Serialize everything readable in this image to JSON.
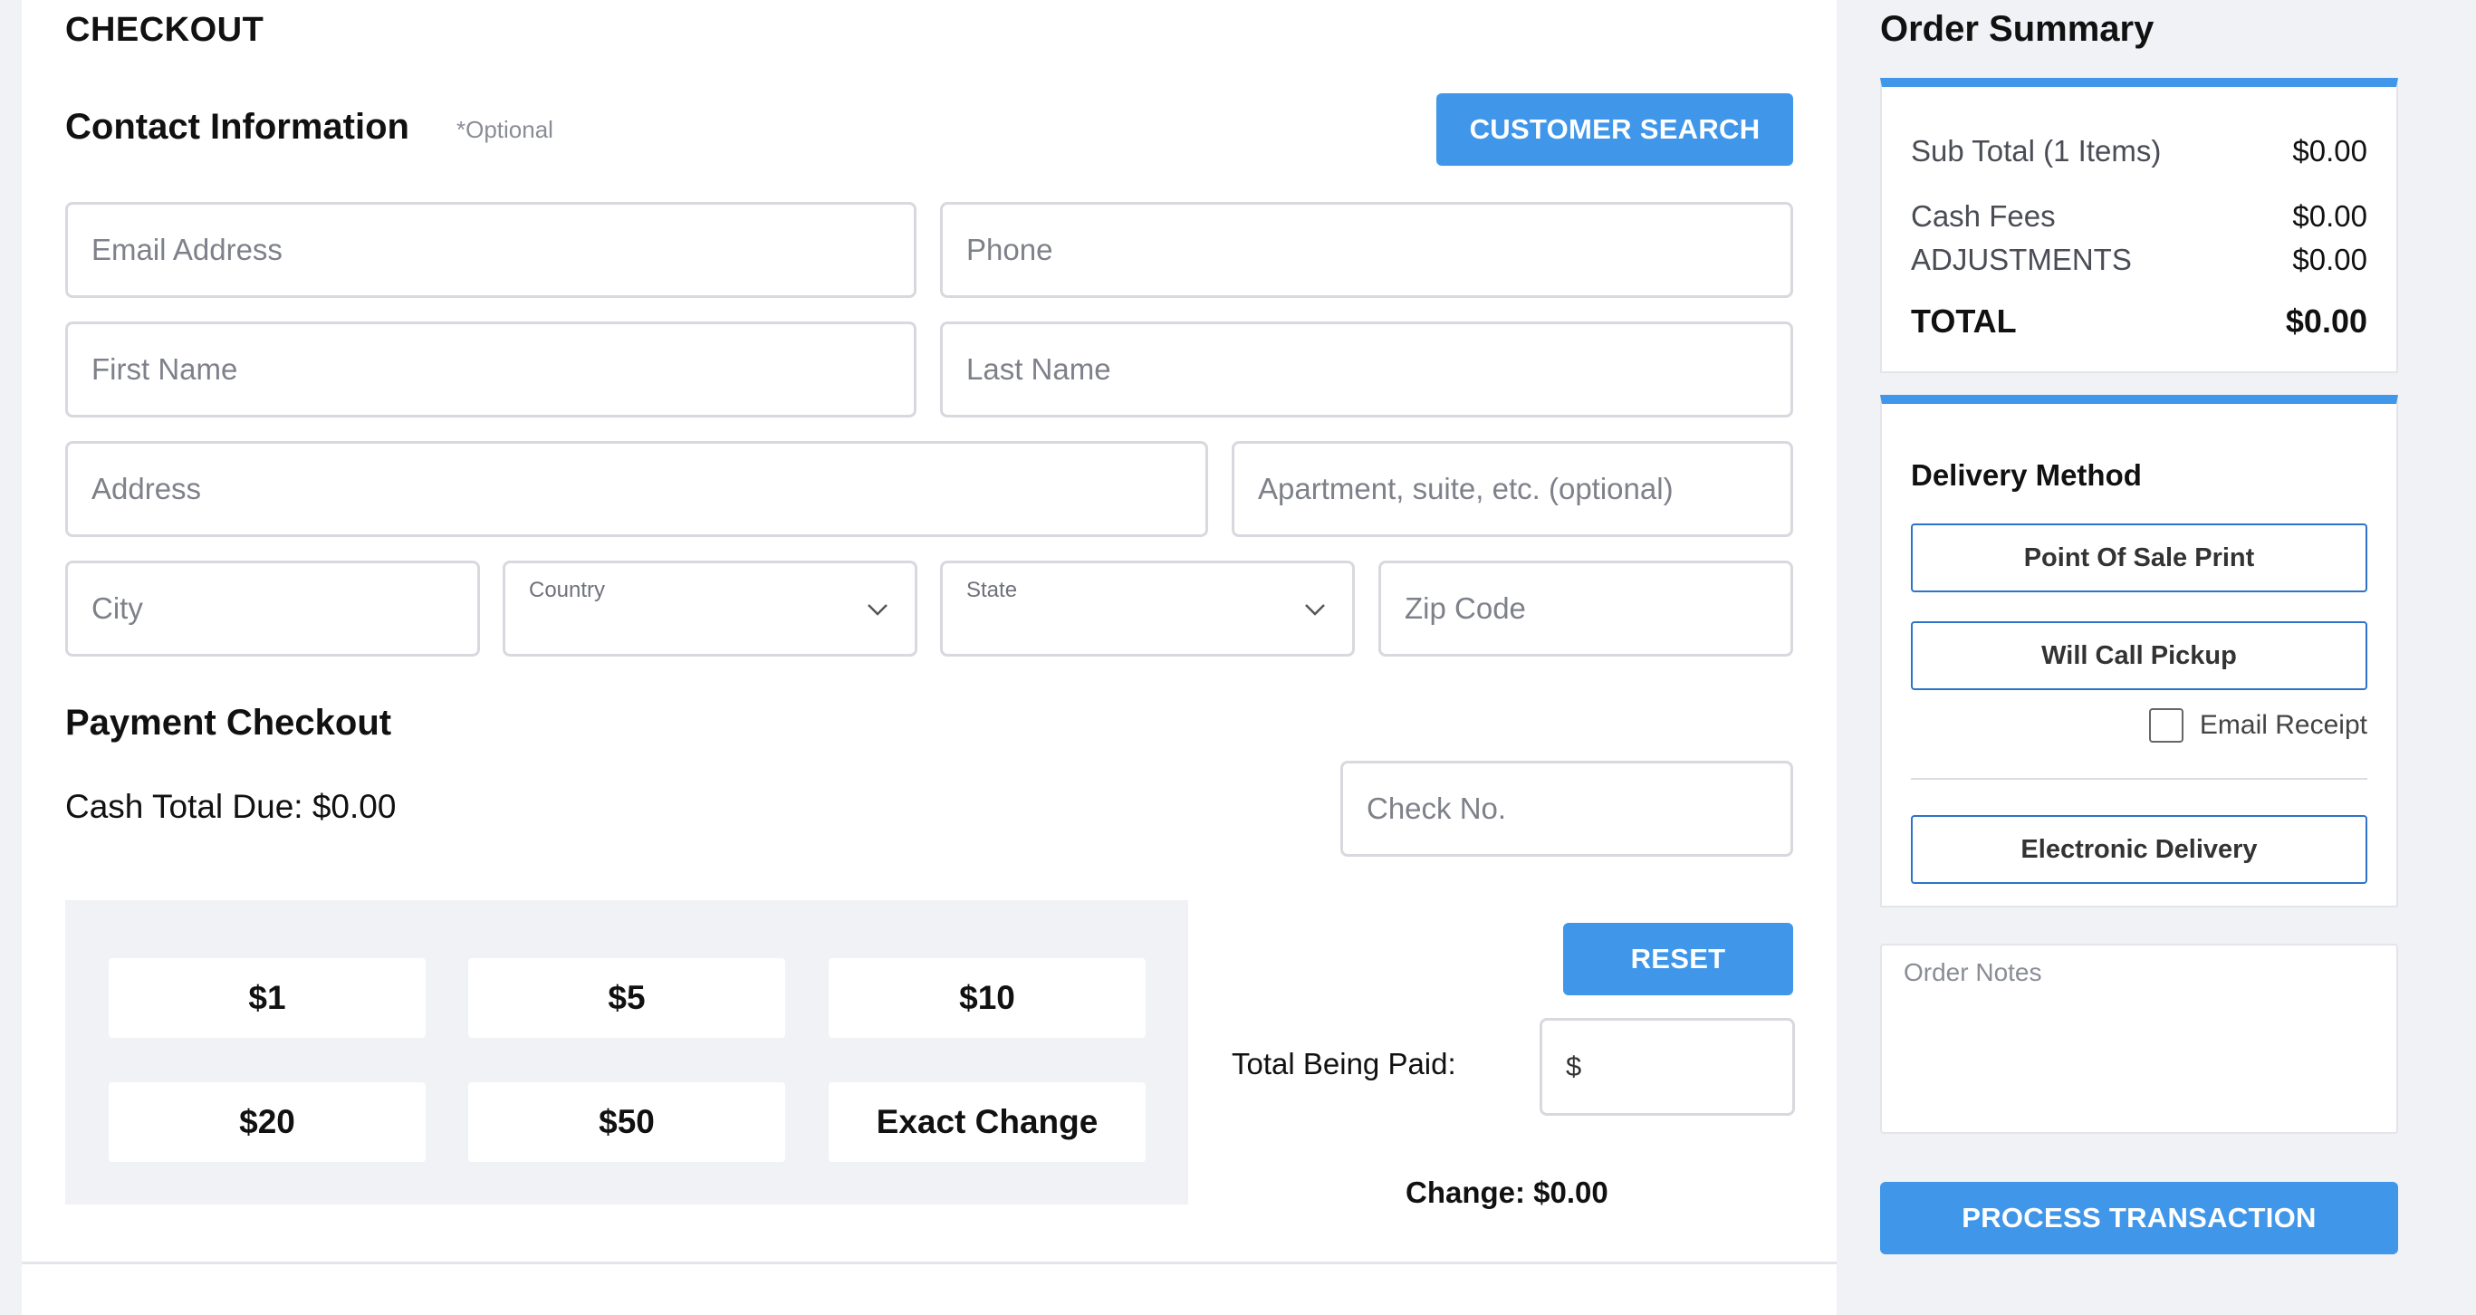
{
  "checkout": {
    "title": "CHECKOUT",
    "contact": {
      "heading": "Contact Information",
      "optional_note": "*Optional",
      "customer_search_label": "CUSTOMER SEARCH",
      "placeholders": {
        "email": "Email Address",
        "phone": "Phone",
        "first_name": "First Name",
        "last_name": "Last Name",
        "address": "Address",
        "apartment": "Apartment, suite, etc. (optional)",
        "city": "City",
        "zip": "Zip Code"
      },
      "country_label": "Country",
      "state_label": "State"
    },
    "payment": {
      "heading": "Payment Checkout",
      "cash_total_due": "Cash Total Due: $0.00",
      "check_no_placeholder": "Check No.",
      "cash_buttons": [
        "$1",
        "$5",
        "$10",
        "$20",
        "$50",
        "Exact Change"
      ],
      "reset_label": "RESET",
      "total_being_paid_label": "Total Being Paid:",
      "total_being_paid_prefix": "$",
      "change": "Change: $0.00"
    }
  },
  "summary": {
    "title": "Order Summary",
    "rows": [
      {
        "label": "Sub Total (1 Items)",
        "value": "$0.00"
      },
      {
        "label": "Cash Fees",
        "value": "$0.00"
      },
      {
        "label": "ADJUSTMENTS",
        "value": "$0.00"
      }
    ],
    "total_label": "TOTAL",
    "total_value": "$0.00"
  },
  "delivery": {
    "title": "Delivery Method",
    "options": [
      "Point Of Sale Print",
      "Will Call Pickup"
    ],
    "email_receipt_label": "Email Receipt",
    "electronic_label": "Electronic Delivery"
  },
  "order_notes_placeholder": "Order Notes",
  "process_label": "PROCESS TRANSACTION",
  "colors": {
    "accent": "#4097e9",
    "page_bg": "#f1f2f6",
    "border": "#d7d9de"
  }
}
